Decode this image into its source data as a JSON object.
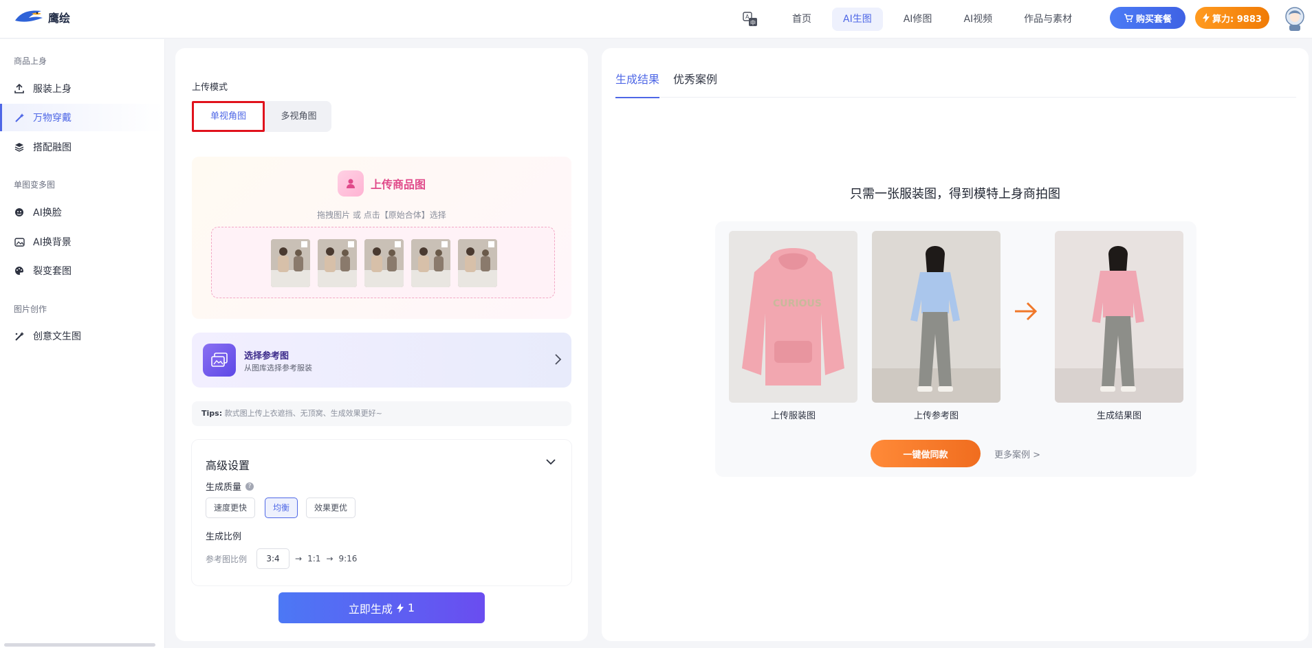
{
  "header": {
    "logo_text": "鹰绘",
    "nav": [
      "首页",
      "AI生图",
      "AI修图",
      "AI视频",
      "作品与素材"
    ],
    "nav_active_index": 1,
    "buy_label": "购买套餐",
    "power_label": "算力: 9883"
  },
  "sidebar": {
    "groups": [
      {
        "title": "商品上身",
        "items": [
          "服装上身",
          "万物穿戴",
          "搭配融图"
        ]
      },
      {
        "title": "单图变多图",
        "items": [
          "AI换脸",
          "AI换背景",
          "裂变套图"
        ]
      },
      {
        "title": "图片创作",
        "items": [
          "创意文生图"
        ]
      }
    ],
    "active_item": "万物穿戴"
  },
  "left": {
    "upload_mode_label": "上传模式",
    "mode_options": [
      "单视角图",
      "多视角图"
    ],
    "upload_title": "上传商品图",
    "upload_hint": "拖拽图片 或 点击【原始合体】选择",
    "ref_title": "选择参考图",
    "ref_sub": "从图库选择参考服装",
    "tips_label": "Tips:",
    "tips_text": "款式图上传上衣遮挡、无顶窝、生成效果更好~",
    "advanced_title": "高级设置",
    "quality_label": "生成质量",
    "quality_options": [
      "速度更快",
      "均衡",
      "效果更优"
    ],
    "quality_active": "均衡",
    "ratio_label": "生成比例",
    "ref_ratio_label": "参考图比例",
    "ref_ratio_value": "3:4",
    "ratio_steps": [
      "1:1",
      "9:16"
    ],
    "generate_label": "立即生成",
    "generate_cost": "1"
  },
  "right": {
    "tabs": [
      "生成结果",
      "优秀案例"
    ],
    "headline": "只需一张服装图，得到模特上身商拍图",
    "captions": [
      "上传服装图",
      "上传参考图",
      "生成结果图"
    ],
    "same_style_label": "一键做同款",
    "more_label": "更多案例 >"
  },
  "colors": {
    "accent": "#4e67e6",
    "orange": "#f07b06",
    "pink": "#e04a8a"
  }
}
